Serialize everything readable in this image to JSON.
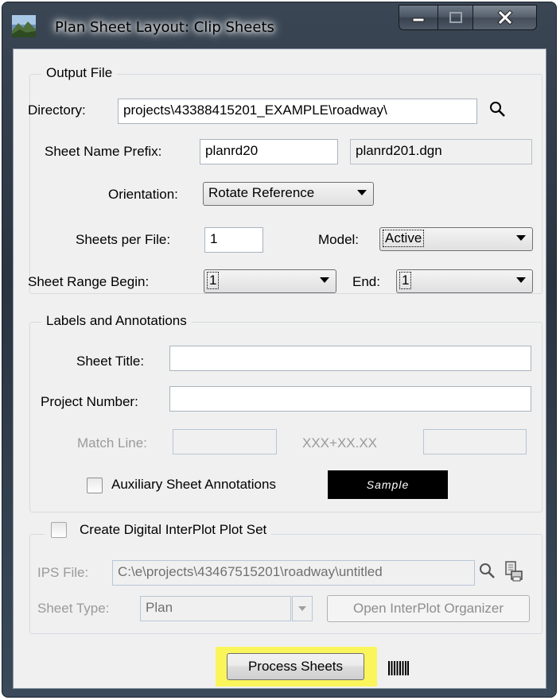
{
  "window": {
    "title": "Plan Sheet Layout: Clip Sheets",
    "accent": "#2d3846"
  },
  "output_file": {
    "legend": "Output File",
    "directory_label": "Directory:",
    "directory_value": "projects\\43388415201_EXAMPLE\\roadway\\",
    "sheet_name_prefix_label": "Sheet Name Prefix:",
    "sheet_name_prefix_value": "planrd20",
    "sheet_name_preview": "planrd201.dgn",
    "orientation_label": "Orientation:",
    "orientation_value": "Rotate Reference",
    "sheets_per_file_label": "Sheets per File:",
    "sheets_per_file_value": "1",
    "model_label": "Model:",
    "model_value": "Active",
    "sheet_range_begin_label": "Sheet Range Begin:",
    "sheet_range_begin_value": "1",
    "end_label": "End:",
    "end_value": "1"
  },
  "labels_annotations": {
    "legend": "Labels and Annotations",
    "sheet_title_label": "Sheet Title:",
    "sheet_title_value": "",
    "project_number_label": "Project Number:",
    "project_number_value": "",
    "match_line_label": "Match Line:",
    "match_line_value": "",
    "station_format": "XXX+XX.XX",
    "station_value": "",
    "auxiliary_label": "Auxiliary Sheet Annotations",
    "auxiliary_checked": false,
    "sample_text": "Sample"
  },
  "interplot": {
    "legend": "Create Digital InterPlot Plot Set",
    "checked": false,
    "ips_file_label": "IPS File:",
    "ips_file_value": "C:\\e\\projects\\43467515201\\roadway\\untitled",
    "sheet_type_label": "Sheet Type:",
    "sheet_type_value": "Plan",
    "open_organizer_label": "Open InterPlot Organizer"
  },
  "footer": {
    "process_sheets_label": "Process Sheets",
    "highlight_color": "#fbf55c"
  }
}
